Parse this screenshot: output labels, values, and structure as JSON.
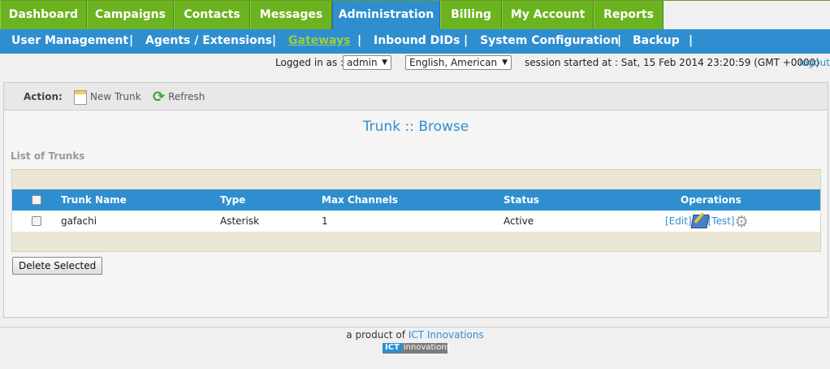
{
  "topnav": {
    "tabs": [
      {
        "label": "Dashboard"
      },
      {
        "label": "Campaigns"
      },
      {
        "label": "Contacts"
      },
      {
        "label": "Messages"
      },
      {
        "label": "Administration",
        "active": true
      },
      {
        "label": "Billing"
      },
      {
        "label": "My Account"
      },
      {
        "label": "Reports"
      }
    ]
  },
  "subnav": {
    "items": [
      {
        "label": "User Management"
      },
      {
        "label": "Agents / Extensions"
      },
      {
        "label": "Gateways",
        "active": true
      },
      {
        "label": "Inbound DIDs"
      },
      {
        "label": "System Configuration"
      },
      {
        "label": "Backup"
      }
    ],
    "separator": "|"
  },
  "session": {
    "logged_in_label": "Logged in as :",
    "user_value": "admin",
    "language_value": "English, American",
    "session_text": "session started at : Sat, 15 Feb 2014 23:20:59 (GMT +0000)",
    "logout_label": "logout"
  },
  "actionbar": {
    "label": "Action:",
    "new_trunk": "New Trunk",
    "refresh": "Refresh"
  },
  "page": {
    "title": "Trunk :: Browse",
    "list_title": "List of Trunks"
  },
  "table": {
    "headers": {
      "name": "Trunk Name",
      "type": "Type",
      "max_channels": "Max Channels",
      "status": "Status",
      "operations": "Operations"
    },
    "rows": [
      {
        "name": "gafachi",
        "type": "Asterisk",
        "max_channels": "1",
        "status": "Active",
        "edit": "[Edit]",
        "test": "[Test]"
      }
    ]
  },
  "buttons": {
    "delete_selected": "Delete Selected"
  },
  "footer": {
    "prefix": "a product of",
    "brand": "ICT Innovations",
    "badge_ict": "ICT",
    "badge_rest": "innovations"
  },
  "colors": {
    "nav_green": "#6bb31f",
    "accent_blue": "#2e8ed0",
    "active_sub": "#9ccf3c"
  }
}
